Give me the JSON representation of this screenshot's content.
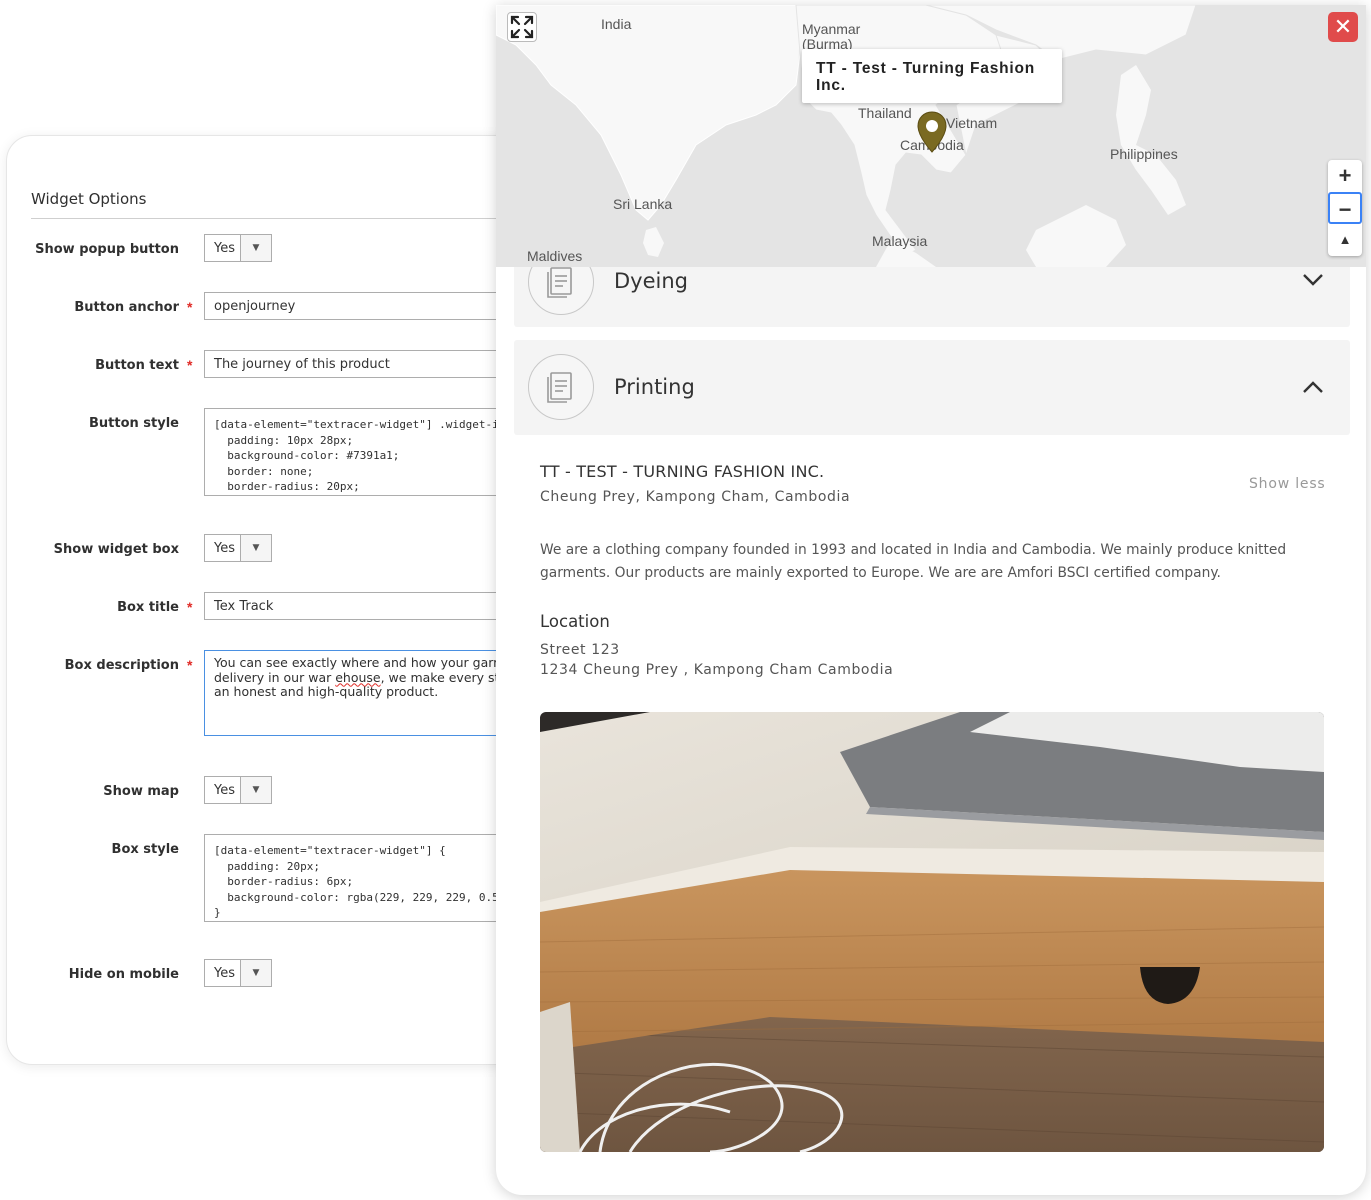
{
  "admin": {
    "section_title": "Widget Options",
    "fields": {
      "show_popup_button": {
        "label": "Show popup button",
        "value": "Yes"
      },
      "button_anchor": {
        "label": "Button anchor",
        "value": "openjourney"
      },
      "button_text": {
        "label": "Button text",
        "value": "The journey of this product"
      },
      "button_style": {
        "label": "Button style",
        "value": "[data-element=\"textracer-widget\"] .widget-i\n  padding: 10px 28px;\n  background-color: #7391a1;\n  border: none;\n  border-radius: 20px;"
      },
      "show_widget_box": {
        "label": "Show widget box",
        "value": "Yes"
      },
      "box_title": {
        "label": "Box title",
        "value": "Tex Track"
      },
      "box_description": {
        "label": "Box description",
        "line1": "You can see exactly where and how your garment",
        "line2_a": "delivery in our war ",
        "line2_b": "ehouse",
        "line2_c": ", we make every step tra",
        "line3": "an honest and high-quality product."
      },
      "show_map": {
        "label": "Show map",
        "value": "Yes"
      },
      "box_style": {
        "label": "Box style",
        "value": "[data-element=\"textracer-widget\"] {\n  padding: 20px;\n  border-radius: 6px;\n  background-color: rgba(229, 229, 229, 0.5\n}"
      },
      "hide_on_mobile": {
        "label": "Hide on mobile",
        "value": "Yes"
      }
    },
    "required_marker": "*"
  },
  "widget": {
    "map": {
      "labels": {
        "india": "India",
        "myanmar": "Myanmar\n(Burma)",
        "thailand": "Thailand",
        "vietnam": "Vietnam",
        "cambodia": "Cambodia",
        "philippines": "Philippines",
        "sri_lanka": "Sri Lanka",
        "malaysia": "Malaysia",
        "maldives": "Maldives"
      },
      "popup_title": "TT - Test - Turning Fashion Inc.",
      "marker_color": "#7a6a22",
      "zoom_in": "+",
      "zoom_out": "−",
      "close": "✕"
    },
    "steps": [
      {
        "title": "Dyeing",
        "expanded": false
      },
      {
        "title": "Printing",
        "expanded": true
      }
    ],
    "company": {
      "name": "TT - TEST - TURNING FASHION INC.",
      "address": "Cheung Prey, Kampong Cham, Cambodia",
      "show_less": "Show less",
      "description": "We are a clothing company founded in 1993 and located in India and Cambodia. We mainly produce knitted garments. Our products are mainly exported to Europe. We are are Amfori BSCI certified company.",
      "location_heading": "Location",
      "location_line1": "Street 123",
      "location_line2": "1234 Cheung Prey , Kampong Cham Cambodia"
    }
  }
}
